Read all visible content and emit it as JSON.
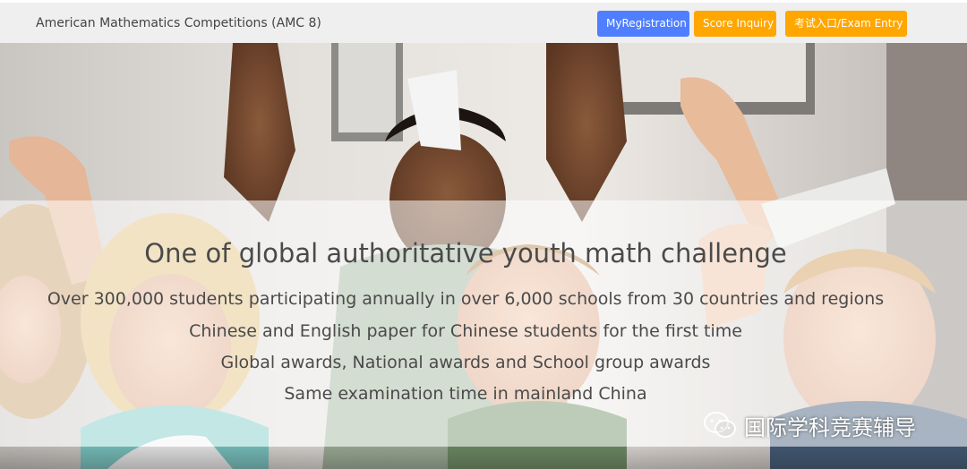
{
  "navbar": {
    "brand": "American Mathematics Competitions (AMC 8)",
    "buttons": {
      "registration": "MyRegistration",
      "score": "Score Inquiry",
      "exam_entry": "考试入口/Exam Entry"
    },
    "colors": {
      "primary": "#4f7fff",
      "warning": "#ffa600"
    }
  },
  "hero": {
    "headline": "One of global authoritative youth math challenge",
    "lines": [
      "Over 300,000 students participating annually in over 6,000 schools from 30 countries and regions",
      "Chinese and English paper for Chinese students for the first time",
      "Global awards, National awards and School group awards",
      "Same examination time in mainland China"
    ]
  },
  "watermark": {
    "icon": "wechat-icon",
    "text": "国际学科竞赛辅导"
  }
}
